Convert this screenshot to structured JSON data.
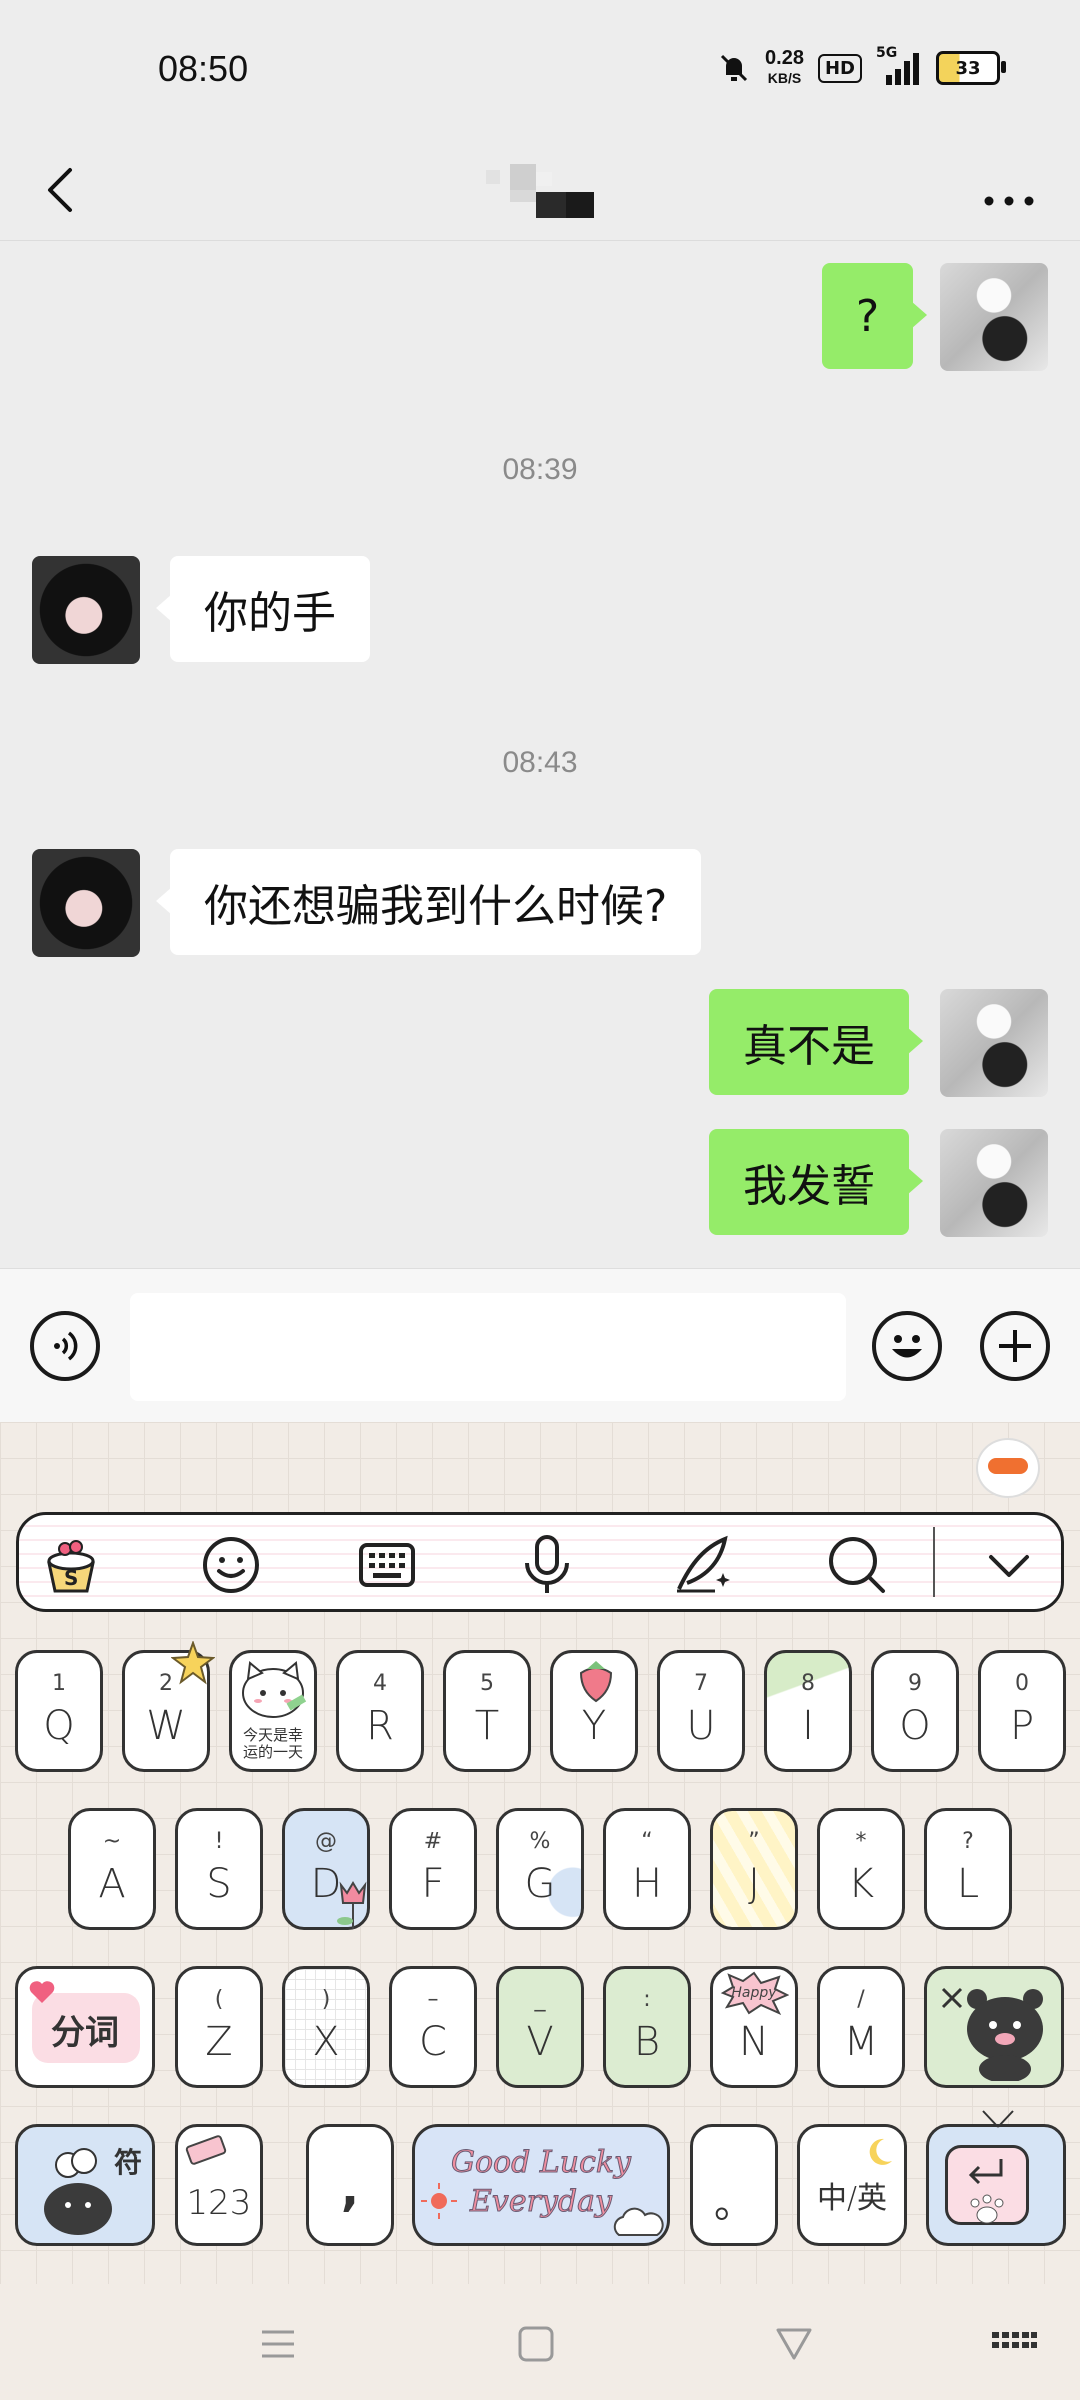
{
  "status_bar": {
    "time": "08:50",
    "net_speed": "0.28",
    "net_speed_unit": "KB/S",
    "hd_badge": "HD",
    "network": "5G",
    "battery": "33"
  },
  "header": {
    "title": ""
  },
  "messages": [
    {
      "side": "me",
      "text": "?"
    },
    {
      "type": "time",
      "text": "08:39"
    },
    {
      "side": "them",
      "text": "你的手"
    },
    {
      "type": "time",
      "text": "08:43"
    },
    {
      "side": "them",
      "text": "你还想骗我到什么时候?"
    },
    {
      "side": "me",
      "text": "真不是"
    },
    {
      "side": "me",
      "text": "我发誓"
    }
  ],
  "input": {
    "placeholder": "",
    "value": ""
  },
  "keyboard": {
    "row1": [
      {
        "main": "Q",
        "sub": "1"
      },
      {
        "main": "W",
        "sub": "2"
      },
      {
        "main": "",
        "sub": "今天是幸运的一天"
      },
      {
        "main": "R",
        "sub": "4"
      },
      {
        "main": "T",
        "sub": "5"
      },
      {
        "main": "Y",
        "sub": ""
      },
      {
        "main": "U",
        "sub": "7"
      },
      {
        "main": "I",
        "sub": "8"
      },
      {
        "main": "O",
        "sub": "9"
      },
      {
        "main": "P",
        "sub": "0"
      }
    ],
    "row2": [
      {
        "main": "A",
        "sub": "~"
      },
      {
        "main": "S",
        "sub": "!"
      },
      {
        "main": "D",
        "sub": "@"
      },
      {
        "main": "F",
        "sub": "#"
      },
      {
        "main": "G",
        "sub": "%"
      },
      {
        "main": "H",
        "sub": "“"
      },
      {
        "main": "J",
        "sub": "”"
      },
      {
        "main": "K",
        "sub": "*"
      },
      {
        "main": "L",
        "sub": "?"
      }
    ],
    "row3": [
      {
        "main": "Z",
        "sub": "("
      },
      {
        "main": "X",
        "sub": ")"
      },
      {
        "main": "C",
        "sub": "–"
      },
      {
        "main": "V",
        "sub": "_"
      },
      {
        "main": "B",
        "sub": ":"
      },
      {
        "main": "N",
        "sub": "Happy"
      },
      {
        "main": "M",
        "sub": "/"
      }
    ],
    "fenci_label": "分词",
    "symbol_label": "符",
    "num_label": "123",
    "comma_label": ",",
    "space_line1": "Good Lucky",
    "space_line2": "Everyday",
    "period_label": "。",
    "lang_label": "中/英"
  }
}
